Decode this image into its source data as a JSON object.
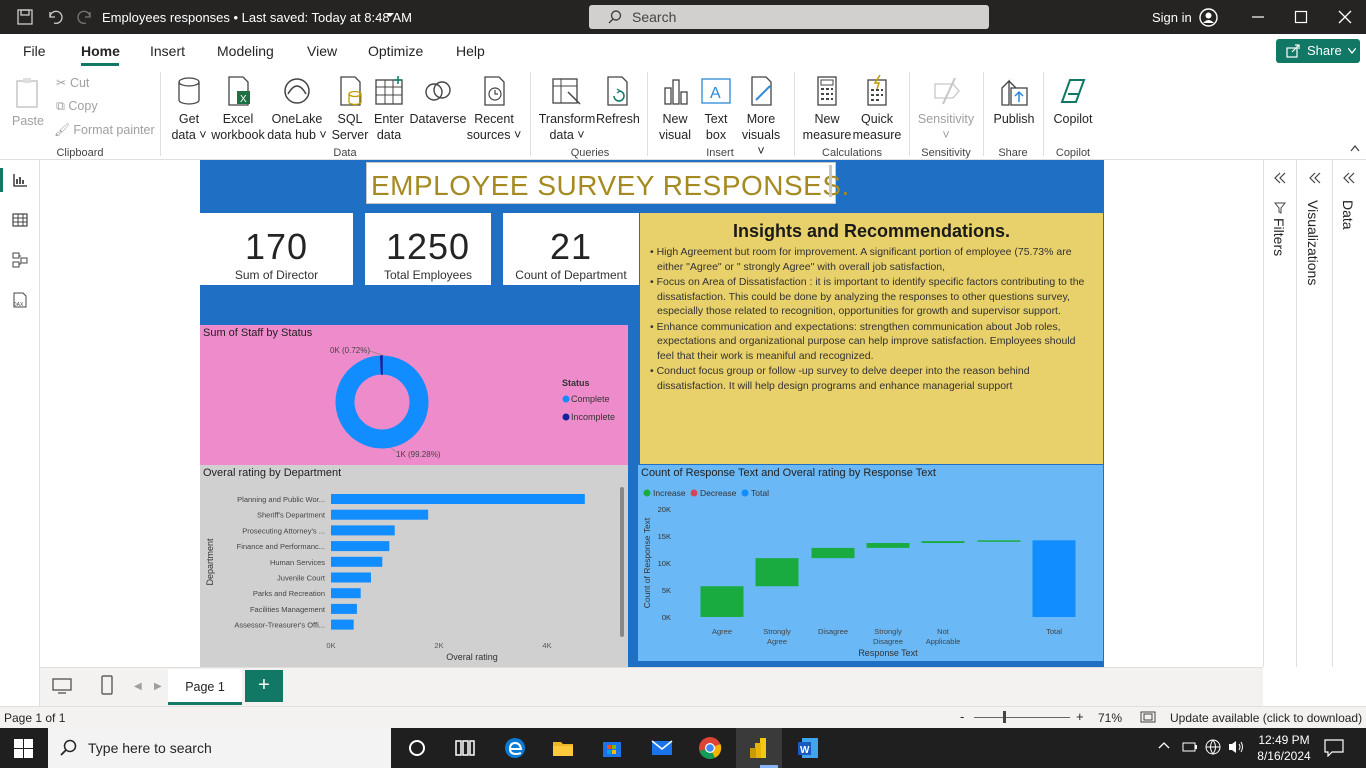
{
  "titlebar": {
    "doc_title": "Employees responses • Last saved: Today at 8:48 AM",
    "search_placeholder": "Search",
    "signin": "Sign in"
  },
  "menu": {
    "file": "File",
    "home": "Home",
    "insert": "Insert",
    "modeling": "Modeling",
    "view": "View",
    "optimize": "Optimize",
    "help": "Help",
    "share": "Share"
  },
  "ribbon": {
    "clipboard": {
      "paste": "Paste",
      "cut": "Cut",
      "copy": "Copy",
      "format_painter": "Format painter",
      "group": "Clipboard"
    },
    "data": {
      "get_data_1": "Get",
      "get_data_2": "data",
      "excel_1": "Excel",
      "excel_2": "workbook",
      "onelake_1": "OneLake",
      "onelake_2": "data hub",
      "sql_1": "SQL",
      "sql_2": "Server",
      "enter_1": "Enter",
      "enter_2": "data",
      "dataverse": "Dataverse",
      "recent_1": "Recent",
      "recent_2": "sources",
      "group": "Data"
    },
    "queries": {
      "transform_1": "Transform",
      "transform_2": "data",
      "refresh": "Refresh",
      "group": "Queries"
    },
    "insert": {
      "new_visual_1": "New",
      "new_visual_2": "visual",
      "textbox_1": "Text",
      "textbox_2": "box",
      "more_1": "More",
      "more_2": "visuals",
      "group": "Insert"
    },
    "calculations": {
      "new_measure_1": "New",
      "new_measure_2": "measure",
      "quick_1": "Quick",
      "quick_2": "measure",
      "group": "Calculations"
    },
    "sensitivity": {
      "label": "Sensitivity",
      "group": "Sensitivity"
    },
    "share": {
      "publish": "Publish",
      "group": "Share"
    },
    "copilot": {
      "label": "Copilot",
      "group": "Copilot"
    }
  },
  "report": {
    "title": "EMPLOYEE SURVEY RESPONSES.",
    "kpis": [
      {
        "value": "170",
        "label": "Sum of Director"
      },
      {
        "value": "1250",
        "label": "Total Employees"
      },
      {
        "value": "21",
        "label": "Count of Department"
      }
    ],
    "insights": {
      "heading": "Insights  and Recommendations.",
      "bullets": [
        "• High Agreement but room for improvement. A significant portion of employee (75.73% are either \"Agree\" or \" strongly Agree\" with overall job satisfaction,",
        "• Focus on Area of Dissatisfaction : it is important to identify specific factors contributing to the dissatisfaction. This could be done by analyzing the responses to other questions survey, especially those related to recognition, opportunities for growth and supervisor support.",
        "• Enhance communication and expectations: strengthen communication about Job roles, expectations and organizational purpose can help improve satisfaction. Employees should feel that their work is meaniful and recognized.",
        "• Conduct focus group or follow -up survey to delve deeper into the reason behind dissatisfaction. It will help design programs and enhance managerial support"
      ]
    }
  },
  "chart_data": [
    {
      "type": "pie",
      "title": "Sum of Staff by Status",
      "legend_title": "Status",
      "legend_position": "right",
      "slices": [
        {
          "label": "Complete",
          "value": 99.28,
          "display": "1K (99.28%)",
          "color": "#118dff"
        },
        {
          "label": "Incomplete",
          "value": 0.72,
          "display": "0K (0.72%)",
          "color": "#12239e"
        }
      ]
    },
    {
      "type": "bar",
      "orientation": "horizontal",
      "title": "Overal rating by Department",
      "xlabel": "Overal rating",
      "ylabel": "Department",
      "categories": [
        "Planning and Public Wor...",
        "Sheriff's Department",
        "Prosecuting Attorney's ...",
        "Finance and Performanc...",
        "Human Services",
        "Juvenile Court",
        "Parks and Recreation",
        "Facilities Management",
        "Assessor-Treasurer's Offi..."
      ],
      "values": [
        4700,
        1800,
        1180,
        1080,
        950,
        740,
        550,
        480,
        420
      ],
      "xticks": [
        "0K",
        "2K",
        "4K"
      ],
      "xlim": [
        0,
        5000
      ],
      "color": "#118dff"
    },
    {
      "type": "waterfall",
      "title": "Count of Response Text and Overal rating by Response Text",
      "xlabel": "Response Text",
      "ylabel": "Count of Response Text",
      "legend": [
        {
          "label": "Increase",
          "color": "#1aab40"
        },
        {
          "label": "Decrease",
          "color": "#d64554"
        },
        {
          "label": "Total",
          "color": "#118dff"
        }
      ],
      "categories": [
        "Agree",
        "Strongly Agree",
        "Disagree",
        "Strongly Disagree",
        "Not Applicable",
        "",
        "Total"
      ],
      "values": [
        5700,
        5200,
        1900,
        900,
        350,
        150,
        14200
      ],
      "yticks": [
        "0K",
        "5K",
        "10K",
        "15K",
        "20K"
      ],
      "ylim": [
        0,
        20000
      ]
    }
  ],
  "pages": {
    "tab": "Page 1",
    "add": "+"
  },
  "panes": {
    "filters": "Filters",
    "visualizations": "Visualizations",
    "data": "Data"
  },
  "statusbar": {
    "page": "Page 1 of 1",
    "zoom": "71%",
    "update": "Update available (click to download)"
  },
  "taskbar": {
    "search": "Type here to search",
    "time": "12:49 PM",
    "date": "8/16/2024"
  }
}
